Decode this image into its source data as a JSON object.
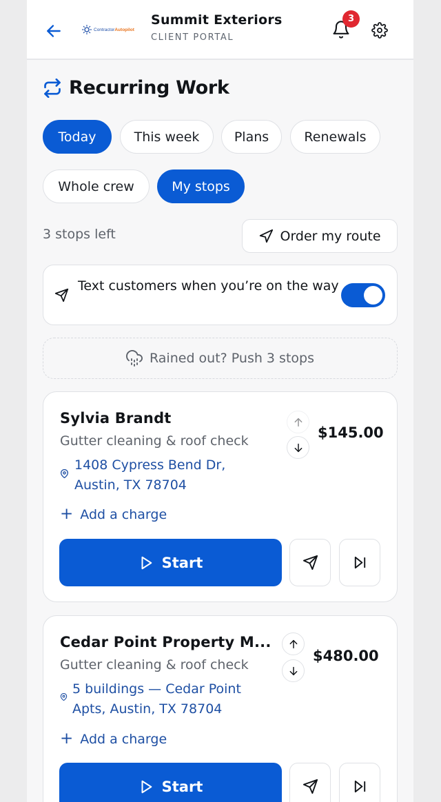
{
  "header": {
    "company": "Summit Exteriors",
    "subtitle": "CLIENT PORTAL",
    "logo_text_left": "Contractor",
    "logo_text_right": "Autopilot",
    "notification_count": "3",
    "icons": {
      "back": "arrow-left-icon",
      "bell": "bell-icon",
      "settings": "gear-icon"
    }
  },
  "section": {
    "title": "Recurring Work",
    "icon": "repeat-icon"
  },
  "period_tabs": [
    {
      "label": "Today",
      "active": true
    },
    {
      "label": "This week",
      "active": false
    },
    {
      "label": "Plans",
      "active": false
    },
    {
      "label": "Renewals",
      "active": false
    }
  ],
  "scope_tabs": [
    {
      "label": "Whole crew",
      "active": false
    },
    {
      "label": "My stops",
      "active": true
    }
  ],
  "stops_left": "3 stops left",
  "order_route_label": "Order my route",
  "notify": {
    "text": "Text customers when you’re on the way",
    "enabled": true
  },
  "rain_label": "Rained out? Push 3 stops",
  "stops": [
    {
      "name": "Sylvia Brandt",
      "service": "Gutter cleaning & roof check",
      "address": "1408 Cypress Bend Dr, Austin, TX 78704",
      "price": "$145.00",
      "add_charge": "Add a charge",
      "start_label": "Start"
    },
    {
      "name": "Cedar Point Property M...",
      "service": "Gutter cleaning & roof check",
      "address": "5 buildings — Cedar Point Apts, Austin, TX 78704",
      "price": "$480.00",
      "add_charge": "Add a charge",
      "start_label": "Start"
    }
  ],
  "colors": {
    "primary": "#0a5bd4",
    "link": "#1e4fa3",
    "badge": "#e02730"
  }
}
